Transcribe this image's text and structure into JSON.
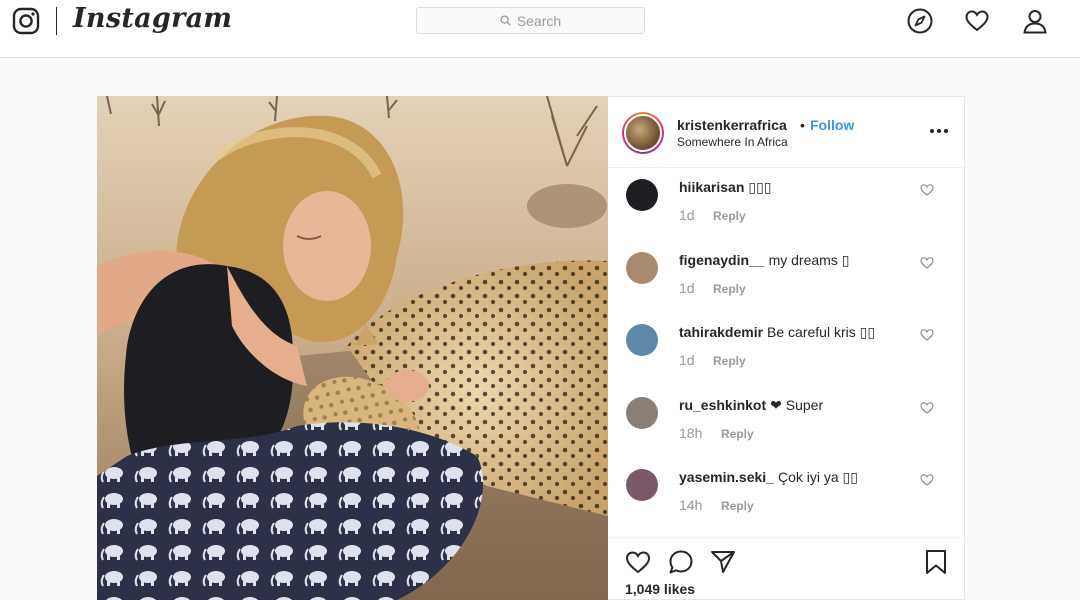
{
  "nav": {
    "logo_text": "Instagram",
    "search_placeholder": "Search",
    "icons": [
      "instagram-glyph-icon",
      "search-icon",
      "explore-compass-icon",
      "activity-heart-icon",
      "profile-icon"
    ]
  },
  "post": {
    "username": "kristenkerrafrica",
    "separator": "•",
    "follow_label": "Follow",
    "location": "Somewhere In Africa",
    "likes": "1,049 likes",
    "colors": {
      "accent": "#3897f0",
      "text": "#262626",
      "muted": "#999999",
      "border": "#dbdbdb"
    }
  },
  "comments": [
    {
      "user": "hiikarisan",
      "text": "▯▯▯",
      "age": "1d",
      "reply": "Reply",
      "avatar_color": "#1e1e22"
    },
    {
      "user": "figenaydin__",
      "text": "my dreams ▯",
      "age": "1d",
      "reply": "Reply",
      "avatar_color": "#a88a70"
    },
    {
      "user": "tahirakdemir",
      "text": "Be careful kris ▯▯",
      "age": "1d",
      "reply": "Reply",
      "avatar_color": "#5d8aa8"
    },
    {
      "user": "ru_eshkinkot",
      "text": "❤ Super",
      "age": "18h",
      "reply": "Reply",
      "avatar_color": "#8a7f76"
    },
    {
      "user": "yasemin.seki_",
      "text": "Çok iyi ya ▯▯",
      "age": "14h",
      "reply": "Reply",
      "avatar_color": "#7a5868"
    }
  ]
}
